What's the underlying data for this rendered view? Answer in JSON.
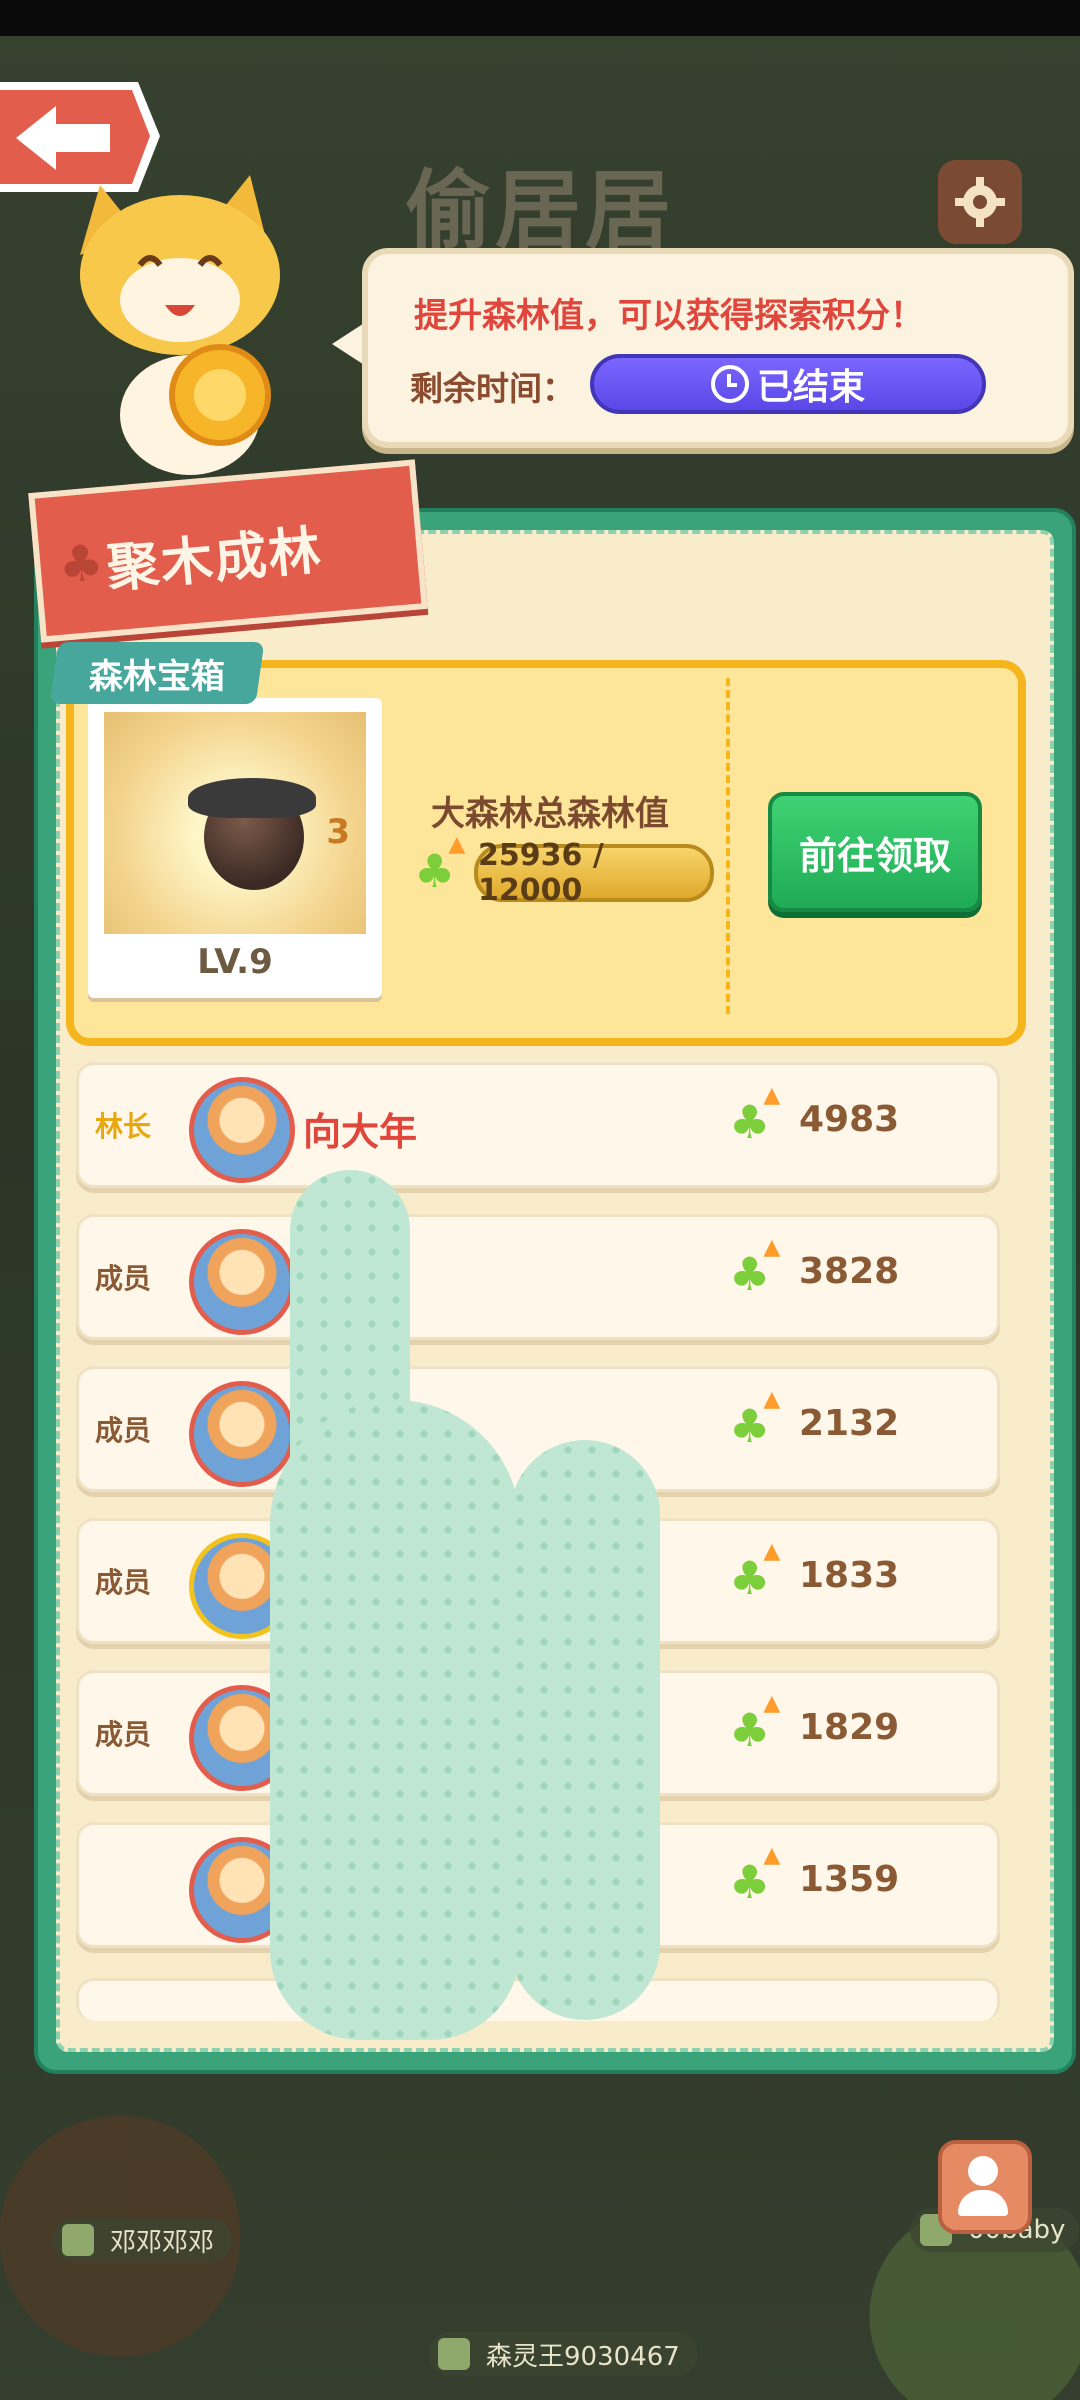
{
  "header": {
    "title": "偷居居",
    "back_icon": "back-arrow-icon",
    "settings_icon": "gear-icon"
  },
  "banner": {
    "hint": "提升森林值，可以获得探索积分！",
    "timer_label": "剩余时间：",
    "timer_value": "已结束"
  },
  "panel": {
    "ribbon_title": "聚木成林",
    "tag": "森林宝箱",
    "chest": {
      "count": "3",
      "level": "LV.9",
      "forest_label": "大森林总森林值",
      "forest_value": "25936 / 12000",
      "claim_button": "前往领取"
    }
  },
  "members": [
    {
      "role": "林长",
      "name": "向大年",
      "score": "4983",
      "ring": "#e35d4d"
    },
    {
      "role": "成员",
      "name": "",
      "score": "3828",
      "ring": "#e35d4d"
    },
    {
      "role": "成员",
      "name": "",
      "score": "2132",
      "ring": "#e35d4d"
    },
    {
      "role": "成员",
      "name": "",
      "score": "1833",
      "ring": "#f2c31f"
    },
    {
      "role": "成员",
      "name": "",
      "score": "1829",
      "ring": "#e35d4d"
    },
    {
      "role": "",
      "name": "",
      "score": "1359",
      "ring": "#e35d4d"
    }
  ],
  "footer": {
    "left_user": "邓邓邓邓",
    "right_user": "00baby",
    "bottom_user": "森灵王9030467"
  }
}
